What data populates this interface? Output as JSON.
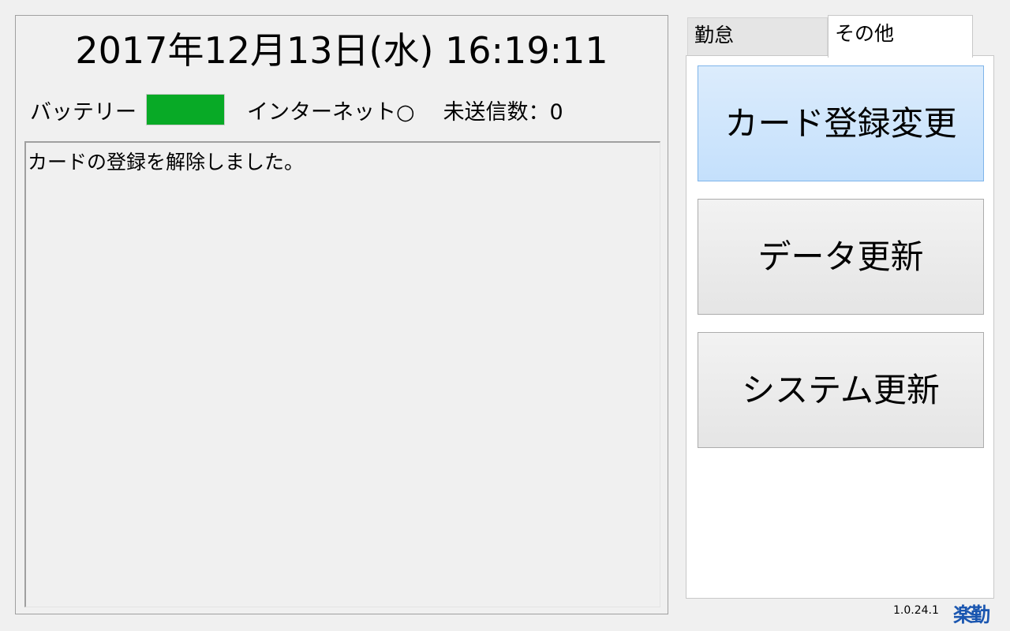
{
  "header": {
    "datetime": "2017年12月13日(水) 16:19:11"
  },
  "status": {
    "battery_label": "バッテリー",
    "battery_color": "#08aa26",
    "internet_label": "インターネット○",
    "unsent_label": "未送信数：0"
  },
  "message": {
    "text": "カードの登録を解除しました。"
  },
  "tabs": [
    {
      "label": "勤怠"
    },
    {
      "label": "その他"
    }
  ],
  "buttons": {
    "card_registration": "カード登録変更",
    "data_update": "データ更新",
    "system_update": "システム更新"
  },
  "footer": {
    "version": "1.0.24.1",
    "logo_text": "楽勤",
    "logo_color": "#1a56b0"
  }
}
